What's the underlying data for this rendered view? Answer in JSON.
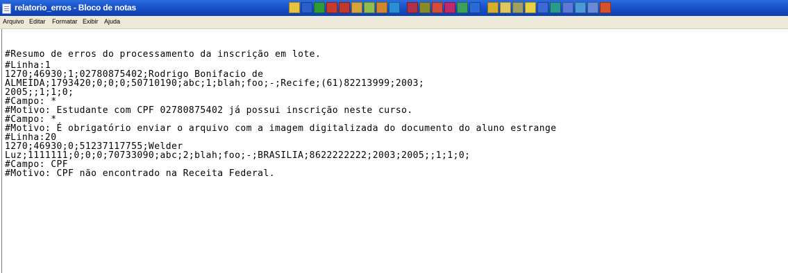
{
  "window": {
    "title": "relatorio_erros - Bloco de notas"
  },
  "menu": [
    "Arquivo",
    "Editar",
    "Formatar",
    "Exibir",
    "Ajuda"
  ],
  "tray_icons": [
    {
      "name": "tray-icon-1",
      "color": "#e8c23a"
    },
    {
      "name": "tray-icon-2",
      "color": "#2b5fc9"
    },
    {
      "name": "tray-icon-3",
      "color": "#2f9a3a"
    },
    {
      "name": "tray-icon-4",
      "color": "#c83a2e"
    },
    {
      "name": "tray-icon-5",
      "color": "#c0392b"
    },
    {
      "name": "tray-icon-6",
      "color": "#d6a53a"
    },
    {
      "name": "tray-icon-7",
      "color": "#8fbf4a"
    },
    {
      "name": "tray-icon-8",
      "color": "#d4882a"
    },
    {
      "name": "tray-icon-9",
      "color": "#2a8fd6"
    },
    {
      "name": "tray-icon-10",
      "color": "#b0304a"
    },
    {
      "name": "tray-icon-11",
      "color": "#8a8a2a"
    },
    {
      "name": "tray-icon-12",
      "color": "#d64a3a"
    },
    {
      "name": "tray-icon-13",
      "color": "#c02a6a"
    },
    {
      "name": "tray-icon-14",
      "color": "#3aa05a"
    },
    {
      "name": "tray-icon-15",
      "color": "#2a6ad6"
    },
    {
      "name": "tray-icon-16",
      "color": "#d6b02a"
    },
    {
      "name": "tray-icon-17",
      "color": "#e0c860"
    },
    {
      "name": "tray-icon-18",
      "color": "#a0a060"
    },
    {
      "name": "tray-icon-19",
      "color": "#e8d040"
    },
    {
      "name": "tray-icon-20",
      "color": "#3a6ad6"
    },
    {
      "name": "tray-icon-21",
      "color": "#2a9a8a"
    },
    {
      "name": "tray-icon-22",
      "color": "#5a7ad6"
    },
    {
      "name": "tray-icon-23",
      "color": "#4a9ad6"
    },
    {
      "name": "tray-icon-24",
      "color": "#6a8ad6"
    },
    {
      "name": "tray-icon-25",
      "color": "#d6502a"
    }
  ],
  "document_lines": [
    "#Resumo de erros do processamento da inscrição em lote.",
    "#Linha:1",
    "1270;46930;1;02780875402;Rodrigo Bonifacio de",
    "ALMEIDA;1793420;0;0;0;50710190;abc;1;blah;foo;-;Recife;(61)82213999;2003;",
    "2005;;1;1;0;",
    "#Campo: *",
    "#Motivo: Estudante com CPF 02780875402 já possui inscrição neste curso.",
    "#Campo: *",
    "#Motivo: É obrigatório enviar o arquivo com a imagem digitalizada do documento do aluno estrange",
    "#Linha:20",
    "1270;46930;0;51237117755;Welder",
    "Luz;1111111;0;0;0;70733090;abc;2;blah;foo;-;BRASILIA;8622222222;2003;2005;;1;1;0;",
    "#Campo: CPF",
    "#Motivo: CPF não encontrado na Receita Federal."
  ]
}
